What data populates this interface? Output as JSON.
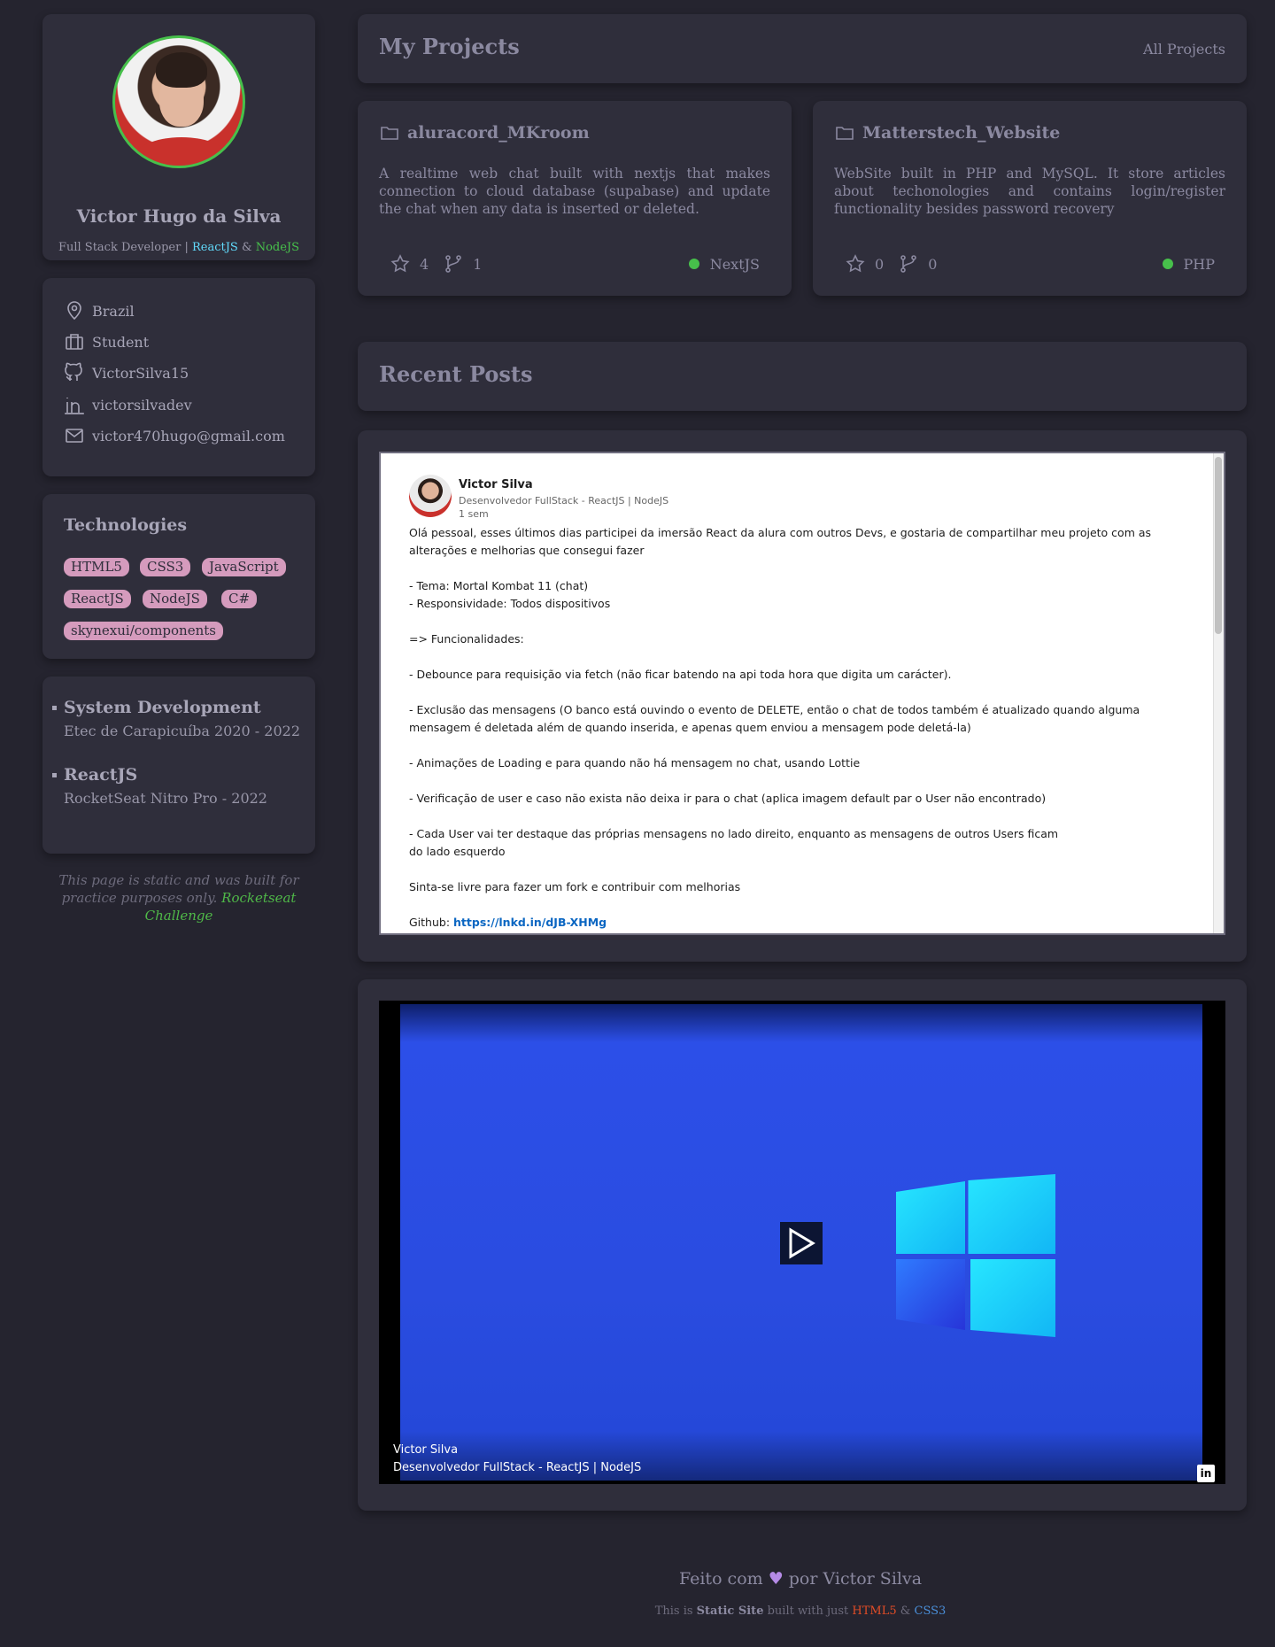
{
  "profile": {
    "name": "Victor Hugo da Silva",
    "role_prefix": "Full Stack Developer | ",
    "role_react": "ReactJS",
    "role_and": " & ",
    "role_node": "NodeJS"
  },
  "contacts": [
    {
      "icon": "map-pin-icon",
      "label": "Brazil"
    },
    {
      "icon": "briefcase-icon",
      "label": "Student"
    },
    {
      "icon": "github-icon",
      "label": "VictorSilva15"
    },
    {
      "icon": "linkedin-icon",
      "label": "victorsilvadev"
    },
    {
      "icon": "mail-icon",
      "label": "victor470hugo@gmail.com"
    }
  ],
  "technologies": {
    "title": "Technologies",
    "tags": [
      "HTML5",
      "CSS3",
      "JavaScript",
      "ReactJS",
      "NodeJS",
      "C#",
      "skynexui/components"
    ]
  },
  "education": [
    {
      "title": "System Development",
      "subtitle": "Etec de Carapicuíba 2020 - 2022"
    },
    {
      "title": "ReactJS",
      "subtitle": "RocketSeat Nitro Pro - 2022"
    }
  ],
  "note": {
    "text": "This page is static and was built for practice purposes only. ",
    "link": "Rocketseat Challenge"
  },
  "projects_header": {
    "title": "My Projects",
    "link": "All Projects"
  },
  "projects": [
    {
      "title": "aluracord_MKroom",
      "description": "A realtime web chat built with nextjs that makes connection to cloud database (supabase) and update the chat when any data is inserted or deleted.",
      "stars": "4",
      "forks": "1",
      "language": "NextJS"
    },
    {
      "title": "Matterstech_Website",
      "description": "WebSite built in PHP and MySQL. It store articles about techonologies and contains login/register functionality besides password recovery",
      "stars": "0",
      "forks": "0",
      "language": "PHP"
    }
  ],
  "posts_header": {
    "title": "Recent Posts"
  },
  "post": {
    "author": "Victor Silva",
    "headline": "Desenvolvedor FullStack - ReactJS | NodeJS",
    "time": "1 sem",
    "lines": [
      "Olá pessoal, esses últimos dias participei da imersão React da alura com outros Devs, e gostaria de compartilhar meu projeto com as alterações e melhorias que consegui fazer",
      "",
      "- Tema: Mortal Kombat 11 (chat)",
      "- Responsividade: Todos dispositivos",
      "",
      "=> Funcionalidades:",
      "",
      "- Debounce para requisição via fetch (não ficar batendo na api toda hora que digita um carácter).",
      "",
      "- Exclusão das mensagens (O banco está ouvindo o evento de DELETE, então o chat de todos também é atualizado quando alguma mensagem é deletada além de quando inserida, e apenas quem enviou a mensagem pode deletá-la)",
      "",
      "- Animações de Loading e para quando não há mensagem no chat, usando Lottie",
      "",
      "- Verificação de user e caso não exista não deixa ir para o chat (aplica imagem default par o User não encontrado)",
      "",
      "- Cada User vai ter destaque das próprias mensagens no lado direito, enquanto as mensagens de outros Users ficam",
      "do lado esquerdo",
      "",
      "Sinta-se livre para fazer um fork e contribuir com melhorias",
      ""
    ],
    "github_label": "Github: ",
    "github_link": "https://lnkd.in/dJB-XHMg"
  },
  "video": {
    "author": "Victor Silva",
    "headline": "Desenvolvedor FullStack - ReactJS | NodeJS",
    "badge": "in"
  },
  "footer": {
    "line1_a": "Feito com ",
    "heart": "♥",
    "line1_b": " por Victor Silva",
    "l2_a": "This is ",
    "l2_b": "Static Site",
    "l2_c": " built with just ",
    "l2_html": "HTML5",
    "l2_and": " & ",
    "l2_css": "CSS3"
  }
}
